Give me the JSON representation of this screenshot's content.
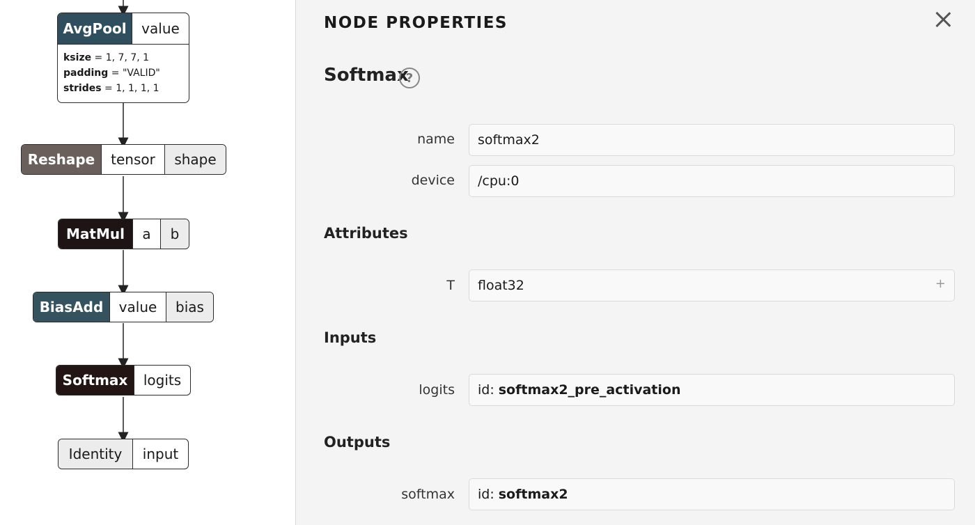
{
  "graph": {
    "nodes": {
      "avgpool": {
        "op": "AvgPool",
        "ports": [
          "value"
        ],
        "attrs": [
          {
            "k": "ksize",
            "v": "= 1, 7, 7, 1"
          },
          {
            "k": "padding",
            "v": "= \"VALID\""
          },
          {
            "k": "strides",
            "v": "= 1, 1, 1, 1"
          }
        ],
        "color": "#2f4f5f"
      },
      "reshape": {
        "op": "Reshape",
        "ports": [
          "tensor",
          "shape"
        ],
        "color": "#6b5f5c"
      },
      "matmul": {
        "op": "MatMul",
        "ports": [
          "a",
          "b"
        ],
        "color": "#1e1414"
      },
      "biasadd": {
        "op": "BiasAdd",
        "ports": [
          "value",
          "bias"
        ],
        "color": "#35535e"
      },
      "softmax": {
        "op": "Softmax",
        "ports": [
          "logits"
        ],
        "color": "#241515"
      },
      "identity": {
        "op": "Identity",
        "ports": [
          "input"
        ]
      }
    }
  },
  "panel": {
    "title": "NODE PROPERTIES",
    "close_icon": "close-icon",
    "op_name": "Softmax",
    "help": "?",
    "fields": {
      "name": {
        "label": "name",
        "value": "softmax2"
      },
      "device": {
        "label": "device",
        "value": "/cpu:0"
      }
    },
    "attributes": {
      "heading": "Attributes",
      "label": "T",
      "value": "float32",
      "expand": "+"
    },
    "inputs": {
      "heading": "Inputs",
      "label": "logits",
      "prefix": "id:",
      "value": "softmax2_pre_activation"
    },
    "outputs": {
      "heading": "Outputs",
      "label": "softmax",
      "prefix": "id:",
      "value": "softmax2"
    }
  }
}
